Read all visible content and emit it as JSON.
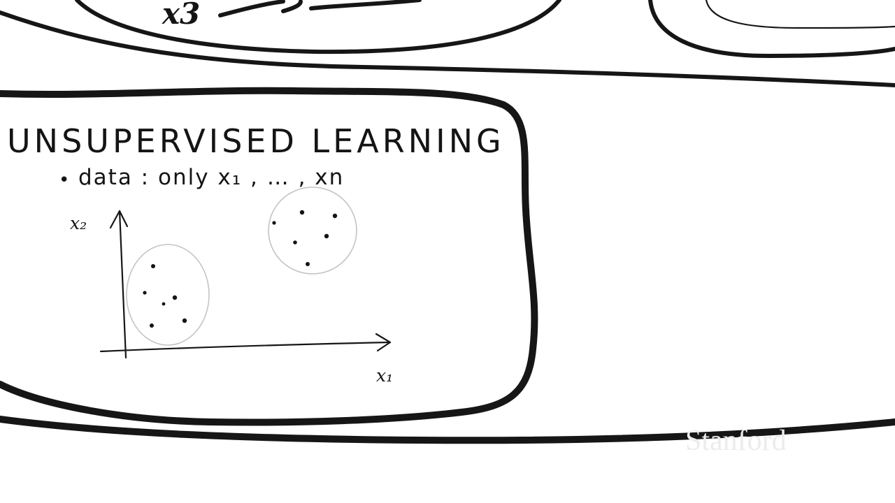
{
  "top_fragment": {
    "partial_label": "x3"
  },
  "panel": {
    "title": "UNSUPERVISED LEARNING",
    "bullet_marker": "•",
    "bullet_text": "data :  only x₁ , … , xn"
  },
  "plot": {
    "y_axis_label": "x₂",
    "x_axis_label": "x₁",
    "clusters": [
      {
        "name": "cluster-left",
        "points": 6
      },
      {
        "name": "cluster-right",
        "points": 6
      }
    ]
  },
  "watermark": "Stanford"
}
